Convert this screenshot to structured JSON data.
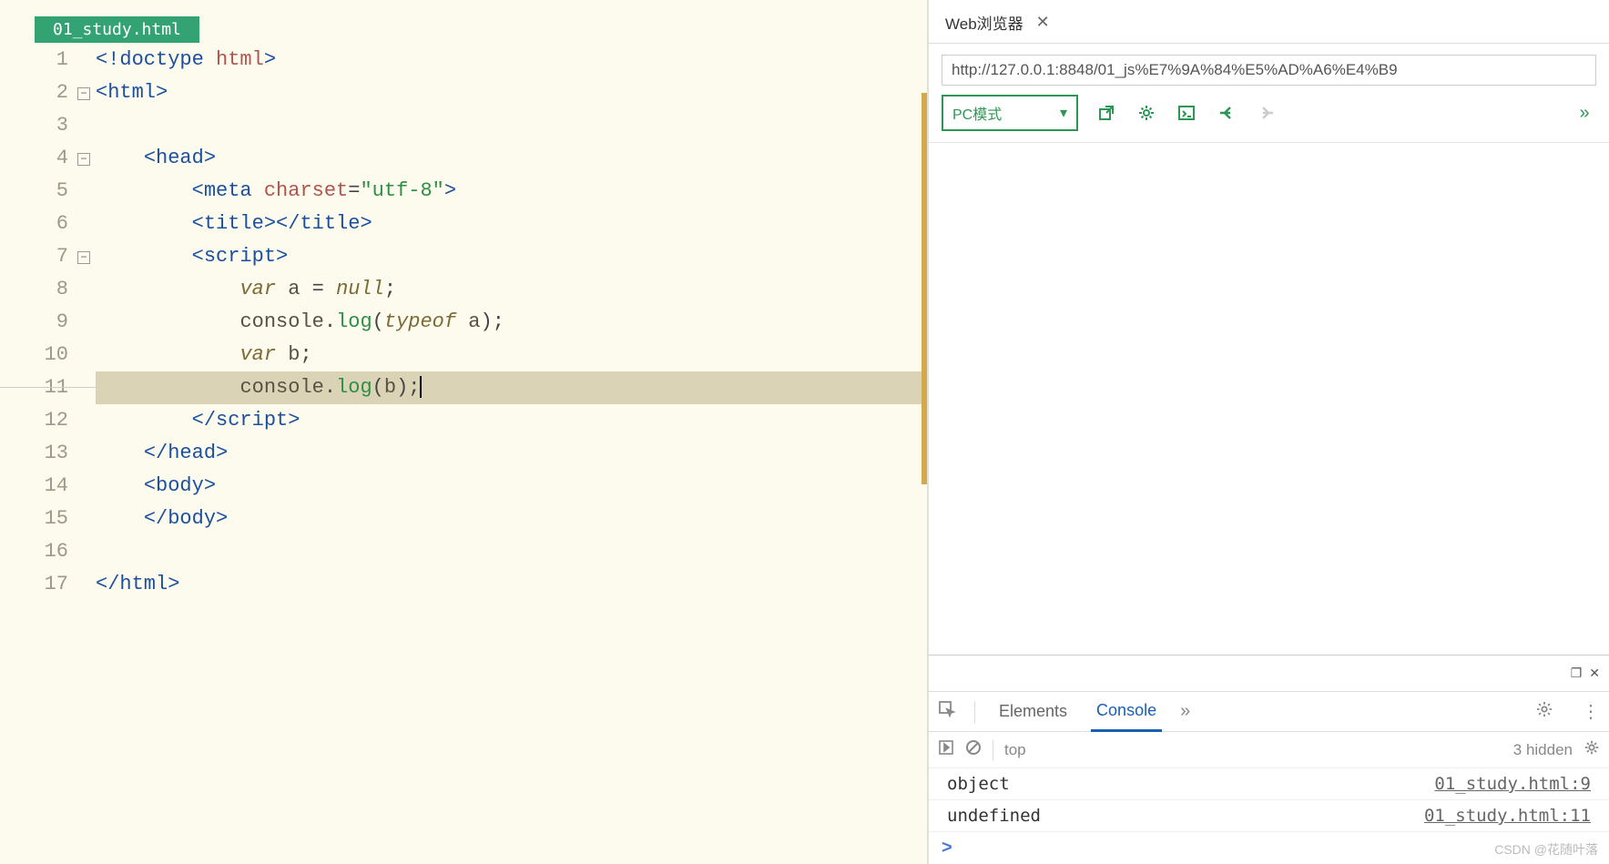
{
  "editor": {
    "tab_name": "01_study.html",
    "lines": [
      {
        "n": 1,
        "fold": "",
        "tokens": [
          [
            "",
            "<",
            "tag"
          ],
          [
            "",
            "!doctype ",
            "tag"
          ],
          [
            "",
            "html",
            "attr"
          ],
          [
            "",
            ">",
            "tag"
          ]
        ]
      },
      {
        "n": 2,
        "fold": "⊟",
        "tokens": [
          [
            "",
            "<html>",
            "tag"
          ]
        ]
      },
      {
        "n": 3,
        "fold": "",
        "tokens": []
      },
      {
        "n": 4,
        "fold": "⊟",
        "tokens": [
          [
            "    ",
            "<head>",
            "tag"
          ]
        ]
      },
      {
        "n": 5,
        "fold": "",
        "tokens": [
          [
            "        ",
            "<meta ",
            "tag"
          ],
          [
            "",
            "charset",
            "attr"
          ],
          [
            "",
            "=",
            "op"
          ],
          [
            "",
            "\"utf-8\"",
            "string"
          ],
          [
            "",
            ">",
            "tag"
          ]
        ]
      },
      {
        "n": 6,
        "fold": "",
        "tokens": [
          [
            "        ",
            "<title></title>",
            "tag"
          ]
        ]
      },
      {
        "n": 7,
        "fold": "⊟",
        "tokens": [
          [
            "        ",
            "<script>",
            "tag"
          ]
        ]
      },
      {
        "n": 8,
        "fold": "",
        "tokens": [
          [
            "            ",
            "var",
            "keyword"
          ],
          [
            "",
            " a ",
            "ident"
          ],
          [
            "",
            "=",
            "op"
          ],
          [
            "",
            " ",
            "ident"
          ],
          [
            "",
            "null",
            "keyword"
          ],
          [
            "",
            ";",
            "op"
          ]
        ]
      },
      {
        "n": 9,
        "fold": "",
        "tokens": [
          [
            "            ",
            "console",
            "ident"
          ],
          [
            "",
            ".",
            "op"
          ],
          [
            "",
            "log",
            "func"
          ],
          [
            "",
            "(",
            "op"
          ],
          [
            "",
            "typeof",
            "keyword"
          ],
          [
            "",
            " a",
            "ident"
          ],
          [
            "",
            ");",
            "op"
          ]
        ]
      },
      {
        "n": 10,
        "fold": "",
        "tokens": [
          [
            "            ",
            "var",
            "keyword"
          ],
          [
            "",
            " b",
            "ident"
          ],
          [
            "",
            ";",
            "op"
          ]
        ]
      },
      {
        "n": 11,
        "fold": "",
        "hl": true,
        "cursor": true,
        "tokens": [
          [
            "            ",
            "console",
            "ident"
          ],
          [
            "",
            ".",
            "op"
          ],
          [
            "",
            "log",
            "func"
          ],
          [
            "",
            "(",
            "op"
          ],
          [
            "",
            "b",
            "ident"
          ],
          [
            "",
            ");",
            "op"
          ]
        ]
      },
      {
        "n": 12,
        "fold": "",
        "tokens": [
          [
            "        ",
            "</script>",
            "tag"
          ]
        ]
      },
      {
        "n": 13,
        "fold": "",
        "tokens": [
          [
            "    ",
            "</head>",
            "tag"
          ]
        ]
      },
      {
        "n": 14,
        "fold": "",
        "tokens": [
          [
            "    ",
            "<body>",
            "tag"
          ]
        ]
      },
      {
        "n": 15,
        "fold": "",
        "tokens": [
          [
            "    ",
            "</body>",
            "tag"
          ]
        ]
      },
      {
        "n": 16,
        "fold": "",
        "tokens": []
      },
      {
        "n": 17,
        "fold": "",
        "tokens": [
          [
            "",
            "</html>",
            "tag"
          ]
        ]
      }
    ]
  },
  "browser": {
    "tab_label": "Web浏览器",
    "url": "http://127.0.0.1:8848/01_js%E7%9A%84%E5%AD%A6%E4%B9",
    "mode": "PC模式"
  },
  "devtools": {
    "tabs": {
      "elements": "Elements",
      "console": "Console"
    },
    "filter_context": "top",
    "hidden_count": "3 hidden",
    "logs": [
      {
        "msg": "object",
        "src": "01_study.html:9"
      },
      {
        "msg": "undefined",
        "src": "01_study.html:11"
      }
    ],
    "prompt": ">"
  },
  "watermark": "CSDN @花随叶落"
}
